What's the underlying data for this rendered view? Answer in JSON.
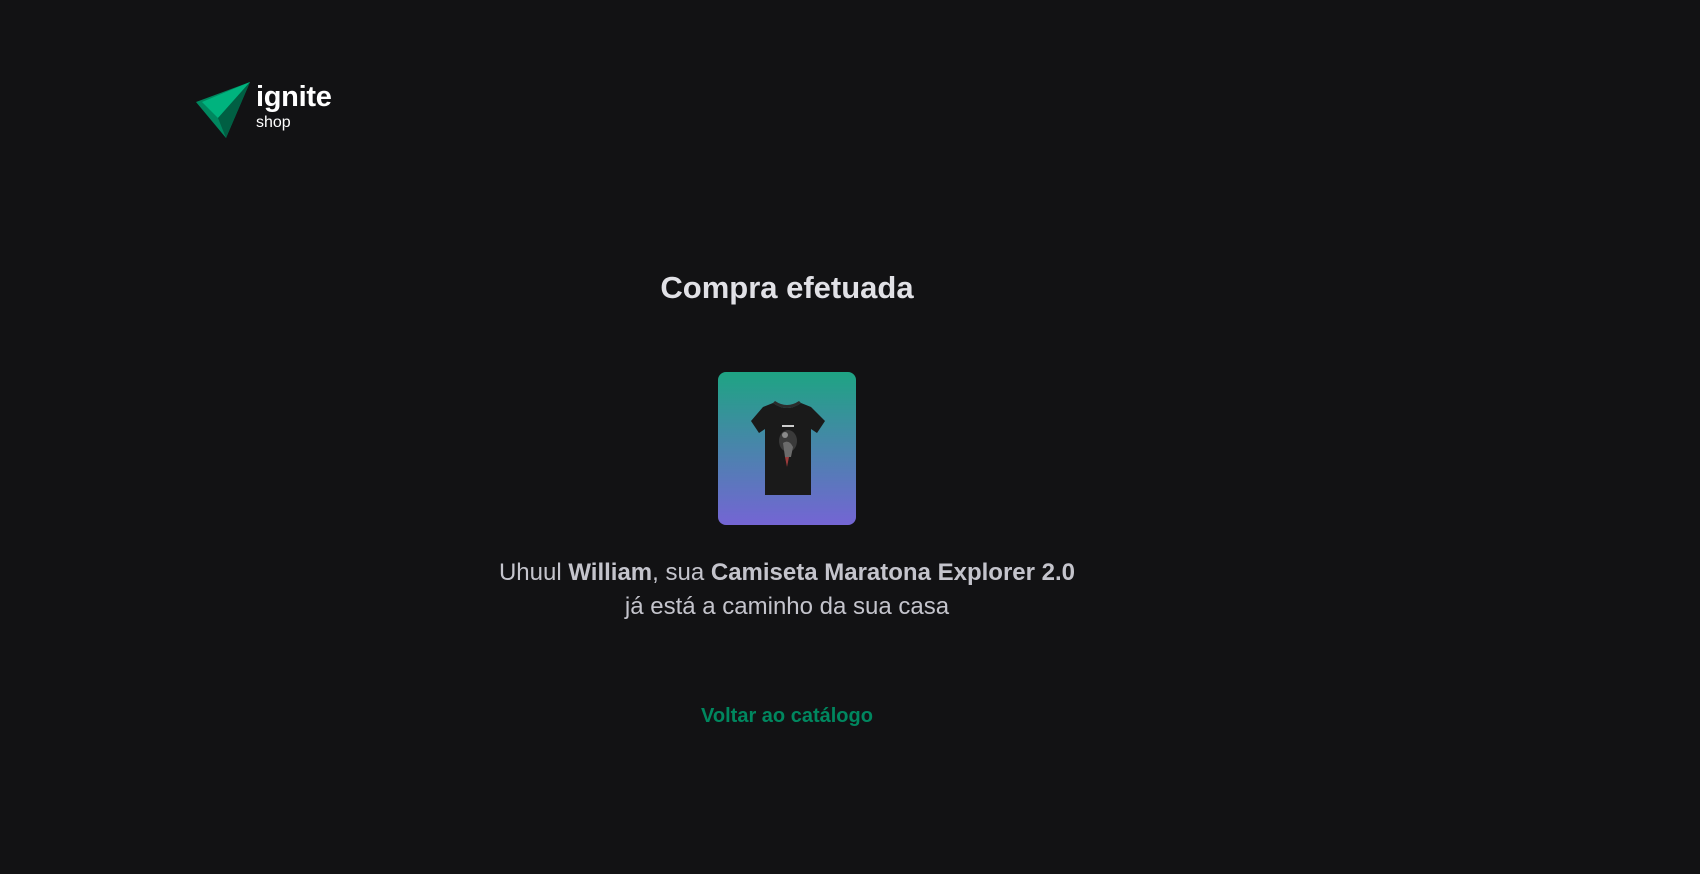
{
  "logo": {
    "word": "ignite",
    "sub": "shop"
  },
  "success": {
    "title": "Compra efetuada",
    "message_prefix": "Uhuul ",
    "customer_name": "William",
    "message_mid": ", sua ",
    "product_name": "Camiseta Maratona Explorer 2.0",
    "message_suffix": "já está a caminho da sua casa",
    "back_label": "Voltar ao catálogo"
  },
  "colors": {
    "background": "#121214",
    "title": "#e1e1e6",
    "text": "#c4c4cc",
    "accent": "#00875f",
    "gradient_start": "#1ea483",
    "gradient_end": "#7465d4"
  },
  "icons": {
    "logo": "paper-plane-triangle-icon"
  }
}
